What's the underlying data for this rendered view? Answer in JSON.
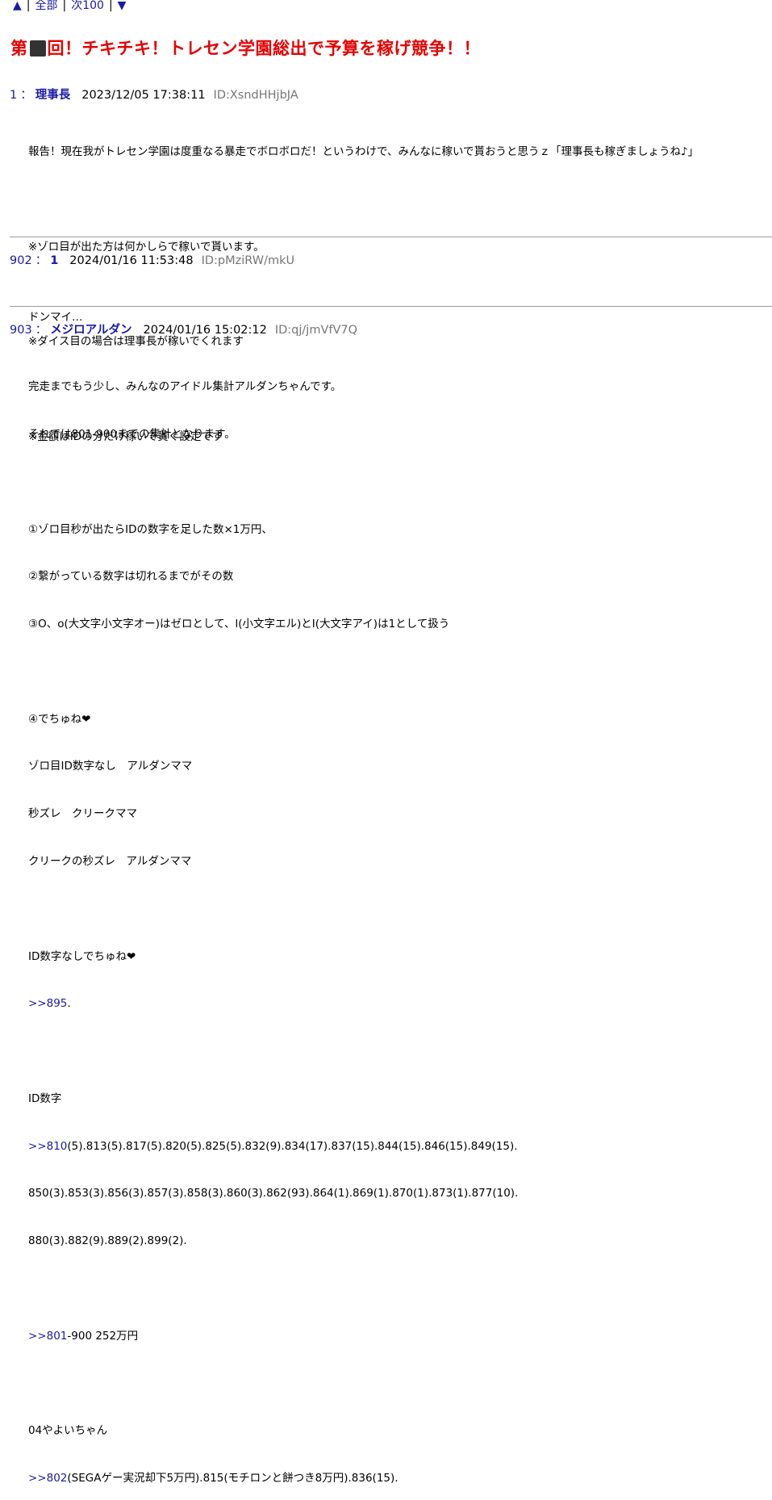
{
  "nav": {
    "up": "▲",
    "all": "全部",
    "next100": "次100",
    "down": "▼"
  },
  "thread": {
    "title_prefix": "第",
    "title_suffix": "回！チキチキ！トレセン学園総出で予算を稼げ競争！！"
  },
  "posts": [
    {
      "num": "1",
      "name": "理事長",
      "date": "2023/12/05 17:38:11",
      "id": "ID:XsndHHjbJA",
      "lines": [
        "報告！現在我がトレセン学園は度重なる暴走でボロボロだ！というわけで、みんなに稼いで貰おうと思うｚ「理事長も稼ぎましょうね♪」",
        "",
        "※ゾロ目が出た方は何かしらで稼いで貰います。",
        "",
        "※ダイス目の場合は理事長が稼いでくれます",
        "",
        "※金額はIDの分だけ稼いで貰ぐ設定です"
      ]
    },
    {
      "num": "902",
      "name": "1",
      "date": "2024/01/16 11:53:48",
      "id": "ID:pMziRW/mkU",
      "lines": [
        "ドンマイ…"
      ]
    },
    {
      "num": "903",
      "name": "メジロアルダン",
      "date": "2024/01/16 15:02:12",
      "id": "ID:qj/jmVfV7Q",
      "lines": [
        "完走までもう少し、みんなのアイドル集計アルダンちゃんです。",
        "それでは801-900までの集計となります。",
        "",
        "①ゾロ目秒が出たらIDの数字を足した数×1万円、",
        "②繋がっている数字は切れるまでがその数",
        "③O、o(大文字小文字オー)はゼロとして、l(小文字エル)とI(大文字アイ)は1として扱う",
        "",
        "④でちゅね❤",
        "ゾロ目ID数字なし　アルダンママ",
        "秒ズレ　クリークママ",
        "クリークの秒ズレ　アルダンママ",
        "",
        "ID数字なしでちゅね❤",
        "",
        "",
        "ID数字",
        "",
        "850(3).853(3).856(3).857(3).858(3).860(3).862(93).864(1).869(1).870(1).873(1).877(10).",
        "880(3).882(9).889(2).899(2).",
        "",
        "",
        "",
        "04やよいちゃん",
        ""
      ],
      "anchors": {
        "a895": ">>895",
        "a895_tail": ".",
        "a810": ">>810",
        "a810_tail": "(5).813(5).817(5).820(5).825(5).832(9).834(17).837(15).844(15).846(15).849(15).",
        "a801": ">>801",
        "a801_tail": "-900 252万円",
        "a802": ">>802",
        "a802_tail": "(SEGAゲー実況却下5万円).815(モチロンと餅つき8万円).836(15)."
      }
    }
  ]
}
